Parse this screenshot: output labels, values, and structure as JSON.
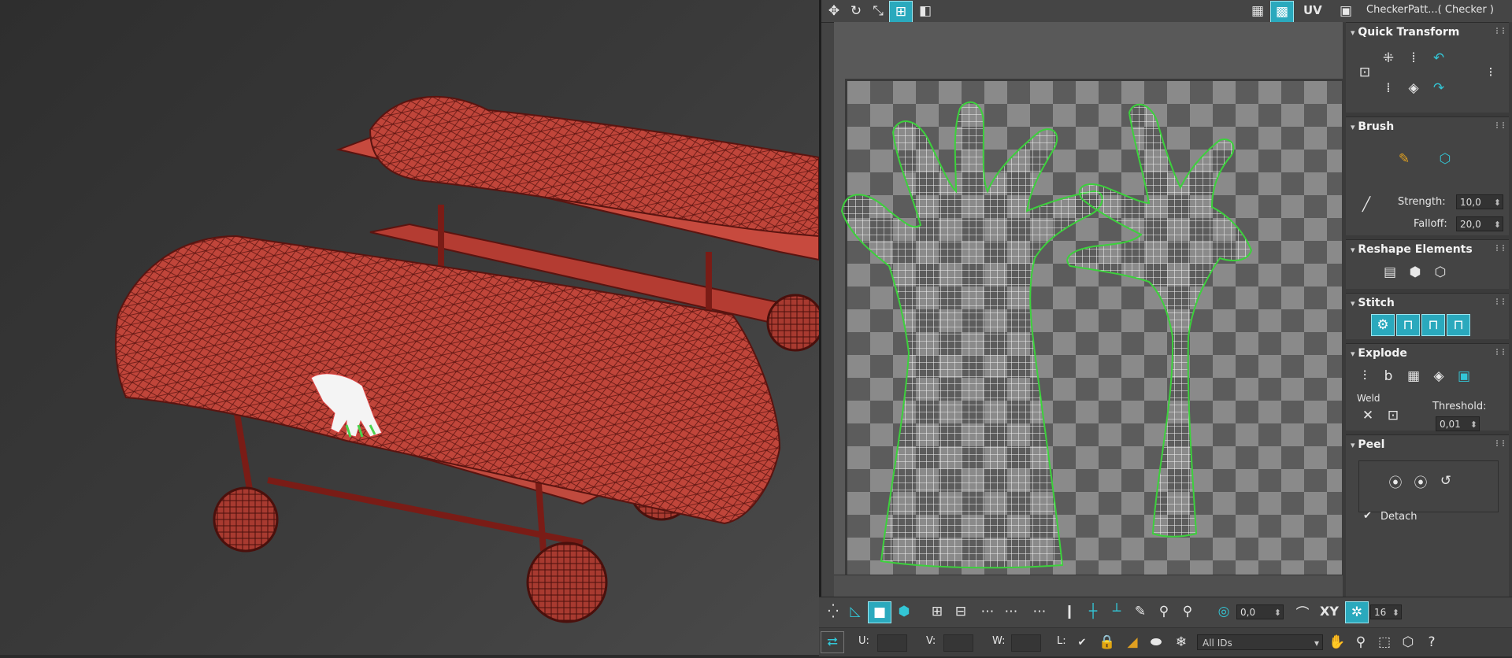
{
  "top_toolbar": {
    "uv_label": "UV",
    "checker_dropdown": "CheckerPatt...( Checker )"
  },
  "panel": {
    "quick_transform": {
      "title": "Quick Transform"
    },
    "brush": {
      "title": "Brush",
      "strength_label": "Strength:",
      "strength_value": "10,0",
      "falloff_label": "Falloff:",
      "falloff_value": "20,0"
    },
    "reshape": {
      "title": "Reshape Elements"
    },
    "stitch": {
      "title": "Stitch"
    },
    "explode": {
      "title": "Explode",
      "weld_label": "Weld",
      "threshold_label": "Threshold:",
      "threshold_value": "0,01"
    },
    "peel": {
      "title": "Peel",
      "detach_label": "Detach",
      "detach_checked": true
    }
  },
  "bottom_toolbar": {
    "angle_value": "0,0",
    "xy_label": "XY",
    "grid_value": "16",
    "u_label": "U:",
    "v_label": "V:",
    "w_label": "W:",
    "l_label": "L:",
    "ids_dropdown": "All IDs"
  },
  "colors": {
    "mesh_red": "#c0453a",
    "wire": "#5a1410",
    "uv_border": "#3cd13c",
    "accent": "#2aa9bd"
  }
}
